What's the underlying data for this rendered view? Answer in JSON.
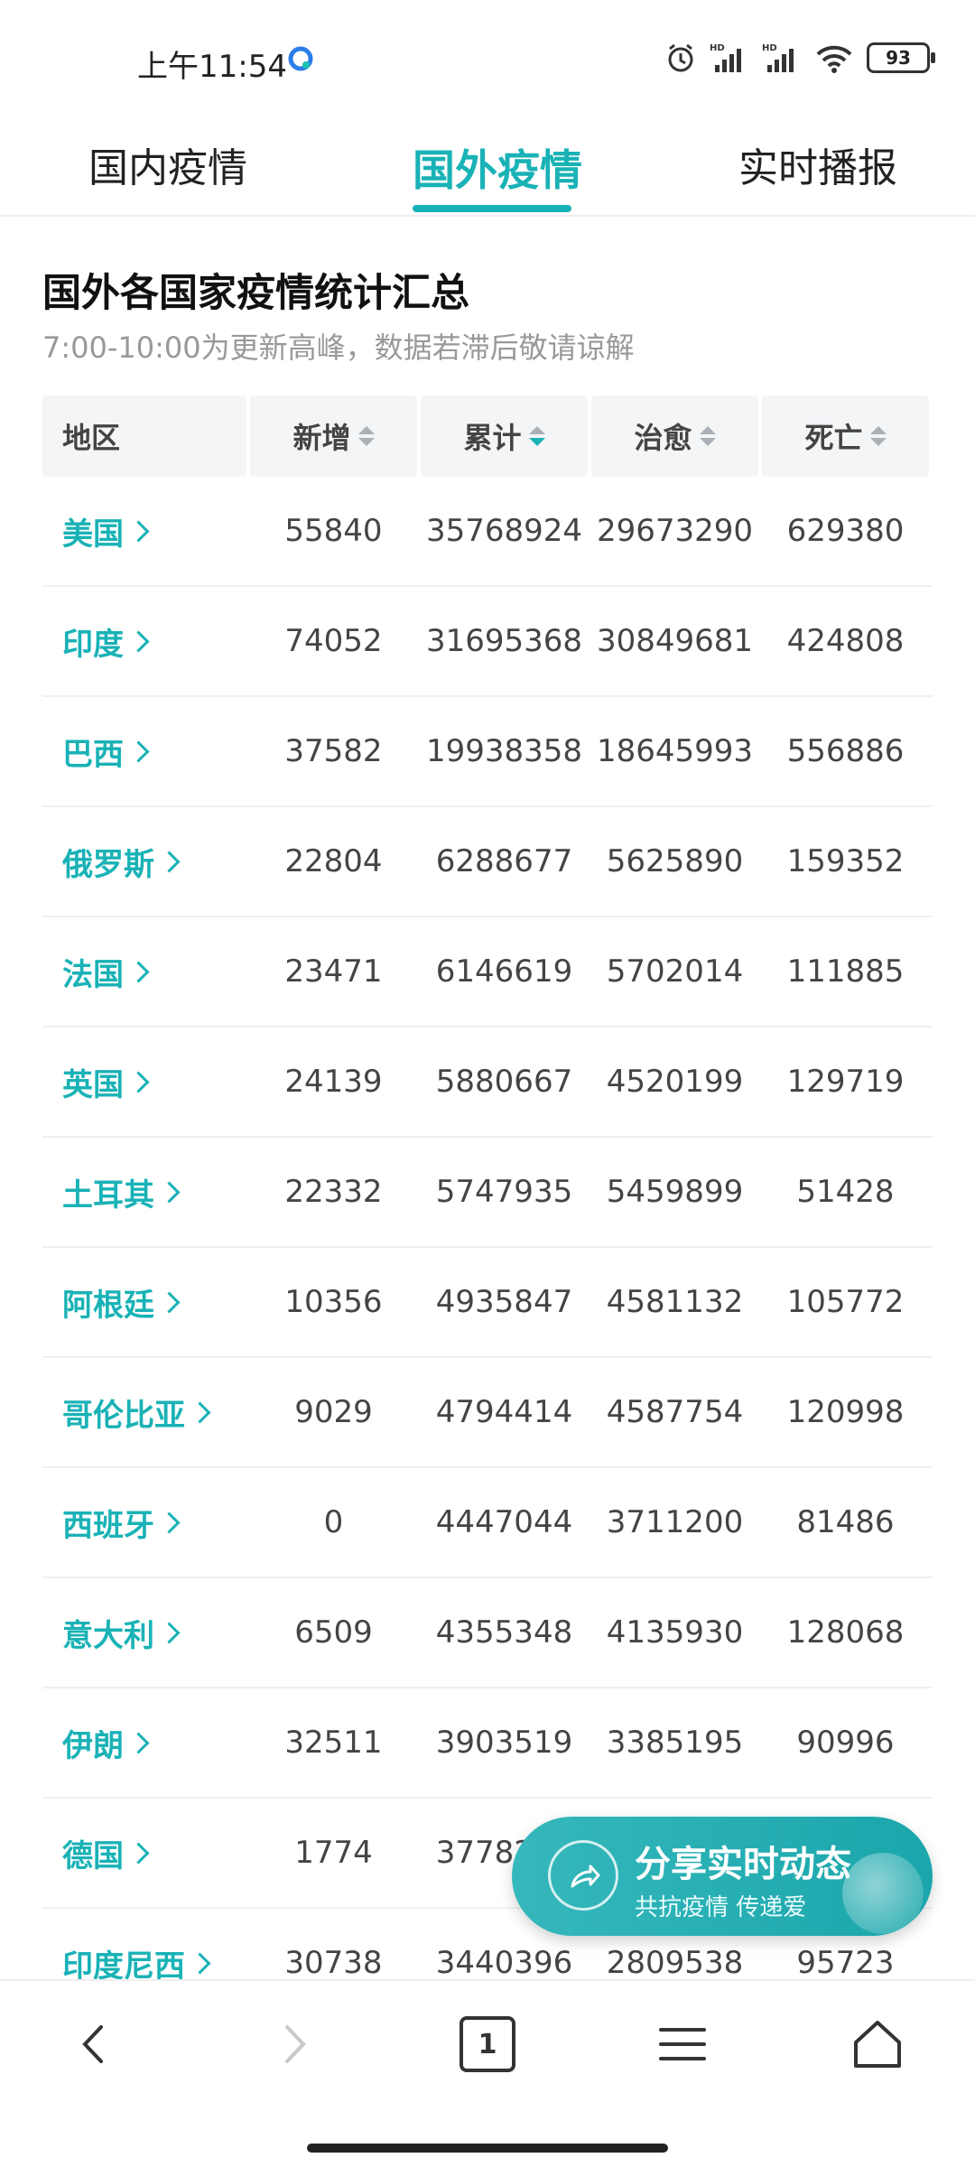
{
  "status_bar": {
    "time": "上午11:54",
    "battery": "93"
  },
  "tabs": [
    {
      "label": "国内疫情",
      "active": false
    },
    {
      "label": "国外疫情",
      "active": true
    },
    {
      "label": "实时播报",
      "active": false
    }
  ],
  "heading": {
    "title": "国外各国家疫情统计汇总",
    "subtitle": "7:00-10:00为更新高峰，数据若滞后敬请谅解"
  },
  "table": {
    "headers": [
      "地区",
      "新增",
      "累计",
      "治愈",
      "死亡"
    ],
    "sorted_column": "累计",
    "rows": [
      [
        "美国",
        "55840",
        "35768924",
        "29673290",
        "629380"
      ],
      [
        "印度",
        "74052",
        "31695368",
        "30849681",
        "424808"
      ],
      [
        "巴西",
        "37582",
        "19938358",
        "18645993",
        "556886"
      ],
      [
        "俄罗斯",
        "22804",
        "6288677",
        "5625890",
        "159352"
      ],
      [
        "法国",
        "23471",
        "6146619",
        "5702014",
        "111885"
      ],
      [
        "英国",
        "24139",
        "5880667",
        "4520199",
        "129719"
      ],
      [
        "土耳其",
        "22332",
        "5747935",
        "5459899",
        "51428"
      ],
      [
        "阿根廷",
        "10356",
        "4935847",
        "4581132",
        "105772"
      ],
      [
        "哥伦比亚",
        "9029",
        "4794414",
        "4587754",
        "120998"
      ],
      [
        "西班牙",
        "0",
        "4447044",
        "3711200",
        "81486"
      ],
      [
        "意大利",
        "6509",
        "4355348",
        "4135930",
        "128068"
      ],
      [
        "伊朗",
        "32511",
        "3903519",
        "3385195",
        "90996"
      ],
      [
        "德国",
        "1774",
        "3778277",
        "",
        ""
      ],
      [
        "印度尼西",
        "30738",
        "3440396",
        "2809538",
        "95723"
      ]
    ]
  },
  "share_button": {
    "title": "分享实时动态",
    "subtitle": "共抗疫情 传递爱"
  },
  "bottom_nav": {
    "tab_count": "1"
  },
  "colors": {
    "accent": "#19b2b6",
    "header_bg": "#f3f5f7"
  }
}
